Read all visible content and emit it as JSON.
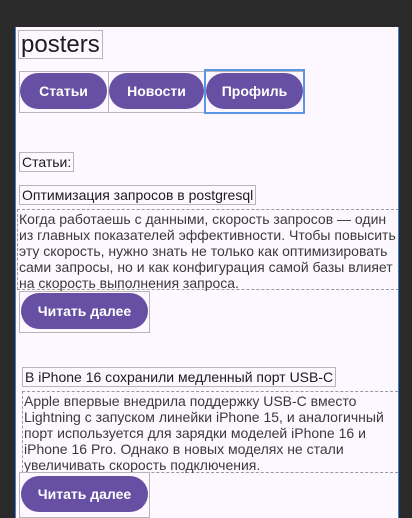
{
  "app": {
    "title": "posters"
  },
  "nav": {
    "tabs": [
      "Статьи",
      "Новости",
      "Профиль"
    ]
  },
  "section": {
    "label": "Статьи:"
  },
  "articles": [
    {
      "title": "Оптимизация запросов в postgresql",
      "summary": "Когда работаешь с данными, скорость запросов — один из главных показателей эффективности. Чтобы повысить эту скорость, нужно знать не только как оптимизировать сами запросы, но и как конфигурация самой базы влияет на скорость выполнения запроса.",
      "read_more": "Читать далее"
    },
    {
      "title": "В iPhone 16 сохранили медленный порт USB-C",
      "summary": "Apple впервые внедрила поддержку USB-C вместо Lightning с запуском линейки iPhone 15, и аналогичный порт используется для зарядки моделей iPhone 16 и iPhone 16 Pro. Однако в новых моделях не стали увеличивать скорость подключения.",
      "read_more": "Читать далее"
    }
  ],
  "colors": {
    "accent": "#6750a4",
    "background": "#fdf7ff",
    "selection": "#3d7ed8"
  }
}
